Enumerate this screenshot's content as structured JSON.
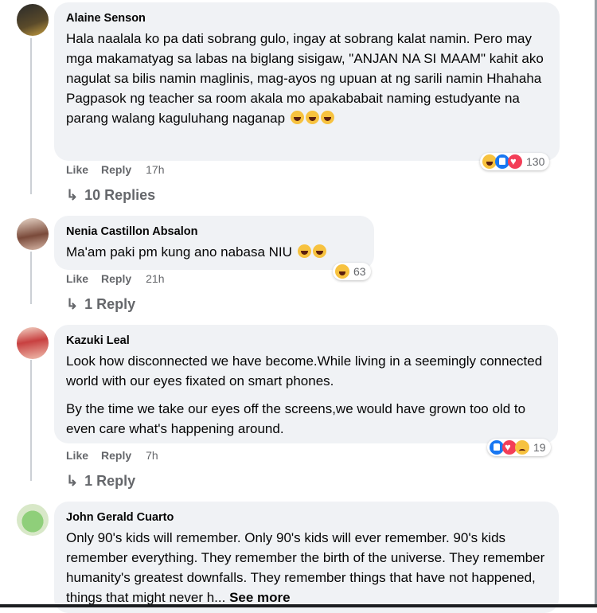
{
  "comments": [
    {
      "author": "Alaine Senson",
      "lines": [
        "Hala naalala ko pa dati sobrang gulo, ingay at sobrang kalat namin. Pero may mga makamatyag sa labas na biglang sisigaw, \"ANJAN NA SI MAAM\" kahit ako nagulat sa bilis namin maglinis, mag-ayos ng upuan at ng sarili namin Hhahaha Pagpasok ng teacher sa room akala mo apakababait naming estudyante na parang walang kaguluhang naganap"
      ],
      "actions": {
        "like": "Like",
        "reply": "Reply",
        "time": "17h"
      },
      "reactions": {
        "count": "130",
        "icons": [
          "haha",
          "like",
          "love"
        ]
      },
      "replies": "10 Replies"
    },
    {
      "author": "Nenia Castillon Absalon",
      "lines": [
        "Ma'am paki pm kung ano nabasa NIU"
      ],
      "actions": {
        "like": "Like",
        "reply": "Reply",
        "time": "21h"
      },
      "reactions": {
        "count": "63",
        "icons": [
          "haha"
        ]
      },
      "replies": "1 Reply"
    },
    {
      "author": "Kazuki Leal",
      "lines": [
        "Look how disconnected we have become.While living in a seemingly connected world with our eyes fixated on smart phones.",
        "By the time we take our eyes off the screens,we would have grown too old to even care what's happening around."
      ],
      "actions": {
        "like": "Like",
        "reply": "Reply",
        "time": "7h"
      },
      "reactions": {
        "count": "19",
        "icons": [
          "like",
          "love",
          "sad"
        ]
      },
      "replies": "1 Reply"
    },
    {
      "author": "John Gerald Cuarto",
      "lines": [
        "Only 90's kids will remember. Only 90's kids will ever remember. 90's kids remember everything. They remember the birth of the universe. They remember humanity's greatest downfalls. They remember things that have not happened, things that might never h..."
      ],
      "see_more": "See more"
    }
  ],
  "colors": {
    "bubble": "#f0f2f5",
    "meta": "#65676b",
    "like": "#1877f2",
    "love": "#f33e58",
    "haha": "#f7c23f"
  }
}
